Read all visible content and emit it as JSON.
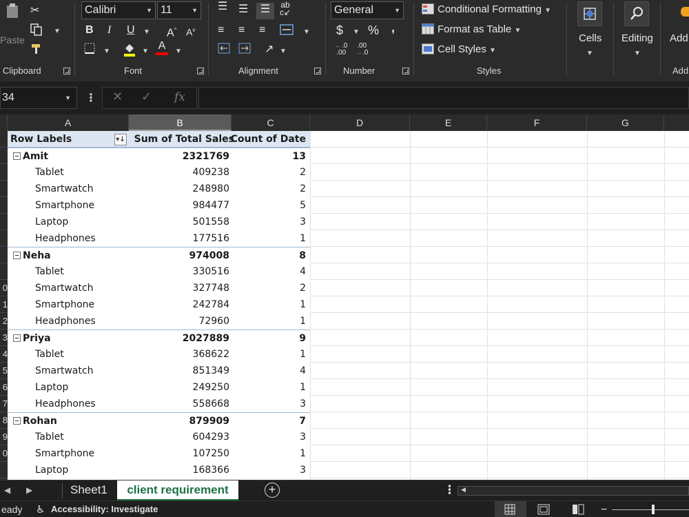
{
  "ribbon": {
    "clipboard": {
      "paste_label": "Paste",
      "group_label": "Clipboard"
    },
    "font": {
      "font_name": "Calibri",
      "font_size": "11",
      "group_label": "Font"
    },
    "alignment": {
      "group_label": "Alignment"
    },
    "number": {
      "format": "General",
      "currency": "$",
      "percent": "%",
      "comma": ",",
      "inc_decimal": ".00",
      "dec_decimal": ".0",
      "group_label": "Number"
    },
    "styles": {
      "conditional_formatting": "Conditional Formatting",
      "format_as_table": "Format as Table",
      "cell_styles": "Cell Styles",
      "group_label": "Styles"
    },
    "cells_label": "Cells",
    "editing_label": "Editing",
    "addins_label": "Add",
    "addins_group_label": "Add"
  },
  "formula_bar": {
    "name_box": "34",
    "fx": "fx",
    "formula": ""
  },
  "columns": [
    "A",
    "B",
    "C",
    "D",
    "E",
    "F",
    "G"
  ],
  "row_headers": [
    "",
    "",
    "",
    "",
    "",
    "",
    "",
    "",
    "",
    "0",
    "1",
    "2",
    "3",
    "4",
    "5",
    "6",
    "7",
    "8",
    "9",
    "0",
    ""
  ],
  "pivot": {
    "headers": [
      "Row Labels",
      "Sum of Total Sales",
      "Count of Date"
    ],
    "rows": [
      {
        "type": "person",
        "label": "Amit",
        "sales": "2321769",
        "count": "13"
      },
      {
        "type": "item",
        "label": "Tablet",
        "sales": "409238",
        "count": "2"
      },
      {
        "type": "item",
        "label": "Smartwatch",
        "sales": "248980",
        "count": "2"
      },
      {
        "type": "item",
        "label": "Smartphone",
        "sales": "984477",
        "count": "5"
      },
      {
        "type": "item",
        "label": "Laptop",
        "sales": "501558",
        "count": "3"
      },
      {
        "type": "item",
        "label": "Headphones",
        "sales": "177516",
        "count": "1"
      },
      {
        "type": "person",
        "label": "Neha",
        "sales": "974008",
        "count": "8"
      },
      {
        "type": "item",
        "label": "Tablet",
        "sales": "330516",
        "count": "4"
      },
      {
        "type": "item",
        "label": "Smartwatch",
        "sales": "327748",
        "count": "2"
      },
      {
        "type": "item",
        "label": "Smartphone",
        "sales": "242784",
        "count": "1"
      },
      {
        "type": "item",
        "label": "Headphones",
        "sales": "72960",
        "count": "1"
      },
      {
        "type": "person",
        "label": "Priya",
        "sales": "2027889",
        "count": "9"
      },
      {
        "type": "item",
        "label": "Tablet",
        "sales": "368622",
        "count": "1"
      },
      {
        "type": "item",
        "label": "Smartwatch",
        "sales": "851349",
        "count": "4"
      },
      {
        "type": "item",
        "label": "Laptop",
        "sales": "249250",
        "count": "1"
      },
      {
        "type": "item",
        "label": "Headphones",
        "sales": "558668",
        "count": "3"
      },
      {
        "type": "person",
        "label": "Rohan",
        "sales": "879909",
        "count": "7"
      },
      {
        "type": "item",
        "label": "Tablet",
        "sales": "604293",
        "count": "3"
      },
      {
        "type": "item",
        "label": "Smartphone",
        "sales": "107250",
        "count": "1"
      },
      {
        "type": "item",
        "label": "Laptop",
        "sales": "168366",
        "count": "3"
      }
    ]
  },
  "sheets": {
    "sheet1": "Sheet1",
    "active": "client requirement"
  },
  "status": {
    "ready": "eady",
    "accessibility": "Accessibility: Investigate"
  },
  "colors": {
    "accent": "#1e7145",
    "pivot_header": "#dce6f2",
    "ribbon_bg": "#2b2b2b"
  }
}
